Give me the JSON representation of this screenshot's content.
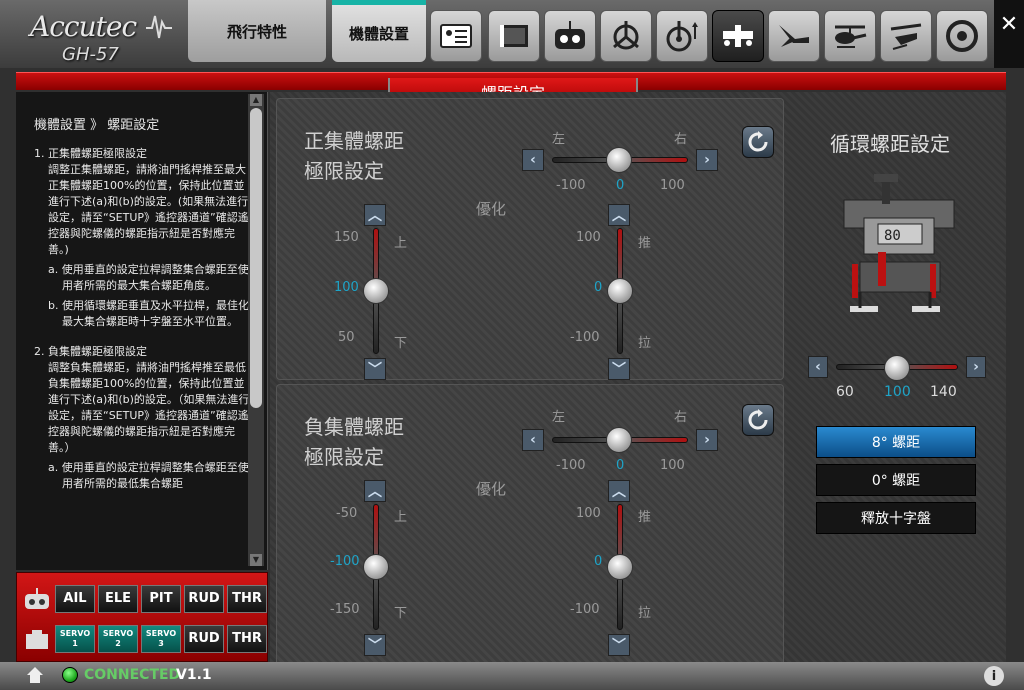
{
  "app": {
    "brand": "Accutec",
    "model": "GH-57"
  },
  "tabs": {
    "flight": "飛行特性",
    "setup": "機體設置"
  },
  "section_title": "螺距設定",
  "help": {
    "title": "機體設置 》 螺距設定",
    "item1_head": "1. 正集體螺距極限設定",
    "item1_body": "調整正集體螺距，請將油門搖桿推至最大正集體螺距100%的位置，保持此位置並進行下述(a)和(b)的設定。(如果無法進行設定，請至“SETUP》遙控器通道”確認遙控器與陀螺儀的螺距指示紐是否對應完善。)",
    "item1_a": "a. 使用垂直的設定拉桿調整集合螺距至使用者所需的最大集合螺距角度。",
    "item1_b": "b. 使用循環螺距垂直及水平拉桿，最佳化最大集合螺距時十字盤至水平位置。",
    "item2_head": "2. 負集體螺距極限設定",
    "item2_body": "調整負集體螺距，請將油門搖桿推至最低負集體螺距100%的位置，保持此位置並進行下述(a)和(b)的設定。（如果無法進行設定，請至“SETUP》遙控器通道”確認遙控器與陀螺儀的螺距指示紐是否對應完善。）",
    "item2_a": "a. 使用垂直的設定拉桿調整集合螺距至使用者所需的最低集合螺距"
  },
  "channels": {
    "row1": [
      "AIL",
      "ELE",
      "PIT",
      "RUD",
      "THR"
    ],
    "row2": [
      {
        "top": "SERVO",
        "bottom": "1"
      },
      {
        "top": "SERVO",
        "bottom": "2"
      },
      {
        "top": "SERVO",
        "bottom": "3"
      },
      {
        "top": "RUD",
        "bottom": ""
      },
      {
        "top": "THR",
        "bottom": ""
      }
    ]
  },
  "positive": {
    "title1": "正集體螺距",
    "title2": "極限設定",
    "left_label": "左",
    "right_label": "右",
    "h_min": "-100",
    "h_val": "0",
    "h_max": "100",
    "optimize": "優化",
    "v1_top": "150",
    "v1_val": "100",
    "v1_bot": "50",
    "v1_up": "上",
    "v1_down": "下",
    "v2_top": "100",
    "v2_val": "0",
    "v2_bot": "-100",
    "v2_up": "推",
    "v2_down": "拉"
  },
  "negative": {
    "title1": "負集體螺距",
    "title2": "極限設定",
    "left_label": "左",
    "right_label": "右",
    "h_min": "-100",
    "h_val": "0",
    "h_max": "100",
    "optimize": "優化",
    "v1_top": "-50",
    "v1_val": "-100",
    "v1_bot": "-150",
    "v1_up": "上",
    "v1_down": "下",
    "v2_top": "100",
    "v2_val": "0",
    "v2_bot": "-100",
    "v2_up": "推",
    "v2_down": "拉"
  },
  "cyclic": {
    "title": "循環螺距設定",
    "display": "80",
    "min": "60",
    "val": "100",
    "max": "140",
    "btn_8": "8° 螺距",
    "btn_0": "0° 螺距",
    "btn_release": "釋放十字盤"
  },
  "status": {
    "connection": "CONNECTED",
    "version": "V1.1"
  },
  "colors": {
    "accent": "#17b3a6",
    "red": "#c11111",
    "blue": "#1ea4c8"
  }
}
